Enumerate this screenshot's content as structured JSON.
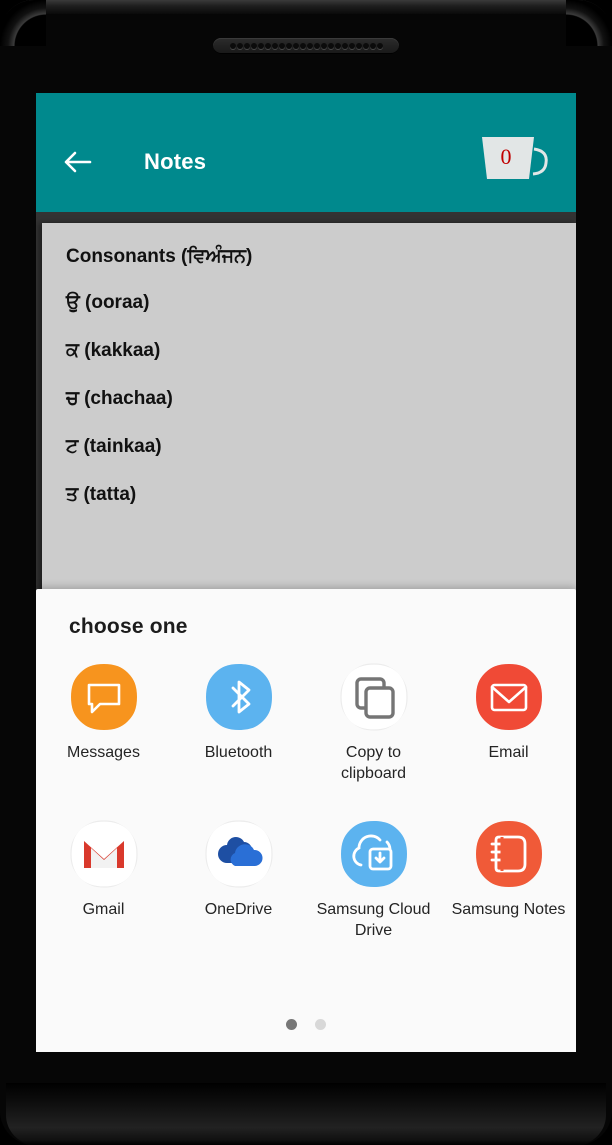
{
  "device": {
    "speaker_holes": 22
  },
  "appbar": {
    "title": "Notes",
    "back_icon": "arrow-left-icon",
    "trash_icon": "trash-bucket-icon",
    "trash_count": "0",
    "bg_color": "#00898d",
    "title_color": "#ffffff",
    "count_color": "#c00000"
  },
  "note": {
    "bg_color": "#cccccc",
    "lines": [
      "Consonants (ਵਿਅੰਜਨ)",
      "ਉ (ooraa)",
      "ਕ (kakkaa)",
      "ਚ (chachaa)",
      "ਟ (tainkaa)",
      "ਤ (tatta)"
    ]
  },
  "sheet": {
    "title": "choose one",
    "bg_color": "#fafafa",
    "rows": [
      [
        {
          "label": "Messages",
          "icon": "messages-chat-bubble-icon",
          "bg": "#f7941e",
          "style": "solid"
        },
        {
          "label": "Bluetooth",
          "icon": "bluetooth-icon",
          "bg": "#5cb3ef",
          "style": "solid"
        },
        {
          "label": "Copy to clipboard",
          "icon": "copy-to-clipboard-icon",
          "bg": "#ffffff",
          "style": "light"
        },
        {
          "label": "Email",
          "icon": "email-envelope-icon",
          "bg": "#f04a36",
          "style": "solid"
        }
      ],
      [
        {
          "label": "Gmail",
          "icon": "gmail-icon",
          "bg": "#ffffff",
          "style": "light"
        },
        {
          "label": "OneDrive",
          "icon": "onedrive-cloud-icon",
          "bg": "#ffffff",
          "style": "light"
        },
        {
          "label": "Samsung Cloud Drive",
          "icon": "samsung-cloud-drive-icon",
          "bg": "#5cb3ef",
          "style": "solid"
        },
        {
          "label": "Samsung Notes",
          "icon": "samsung-notes-icon",
          "bg": "#f05a38",
          "style": "solid"
        }
      ]
    ],
    "pagination": {
      "total": 2,
      "active_index": 0,
      "active_color": "#777777",
      "inactive_color": "#d8d8d8"
    }
  }
}
